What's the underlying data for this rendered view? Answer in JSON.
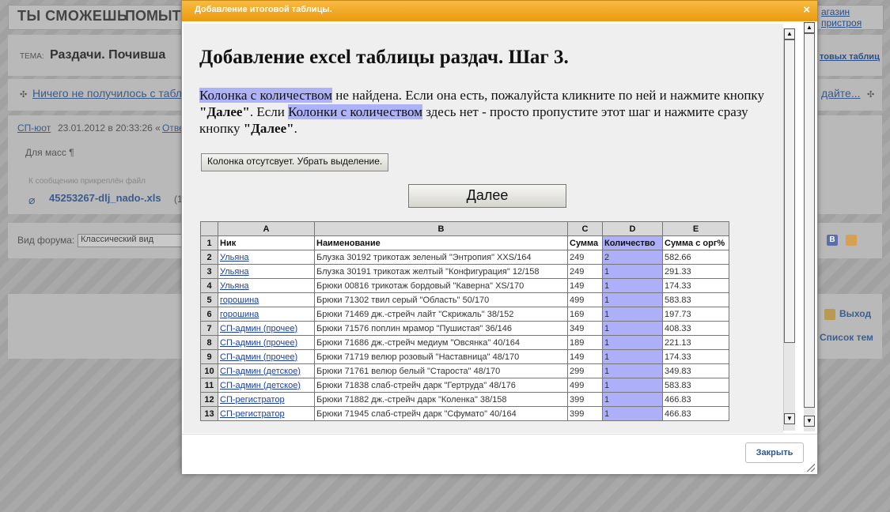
{
  "background": {
    "slogan_1": "ТЫ СМОЖЕШЬ",
    "slogan_2": "ПОМЫТЬ",
    "shop_link": "агазин пристроя",
    "topic_label": "ТЕМА:",
    "topic_title": "Раздачи. Почивша",
    "right_link": "товых таблиц",
    "nav_link_1": "Ничего не получилось с табл",
    "nav_link_2": "дайте...",
    "post_author": "СП-юот",
    "post_date": "23.01.2012 в 20:33:26 «",
    "post_reply": "Отве",
    "post_text": "Для масс ¶",
    "attach_label": "К сообщению прикреплён файл",
    "attach_file": "45253267-dlj_nado-.xls",
    "attach_extra": "(1",
    "forum_view_label": "Вид форума:",
    "forum_view_value": "Классический вид",
    "exit_link": "Выход",
    "topics_link": "Список тем"
  },
  "modal": {
    "title": "Добавление итоговой таблицы.",
    "close_glyph": "×",
    "heading": "Добавление excel таблицы раздач. Шаг 3.",
    "para_hl1": "Колонка с количеством",
    "para_t1": " не найдена. Если она есть, пожалуйста кликните по ней и нажмите кнопку ",
    "para_b1": "\"Далее\"",
    "para_t2": ". Если ",
    "para_hl2": "Колонки с количеством",
    "para_t3": " здесь нет - просто пропустите этот шаг и нажмите сразу кнопку ",
    "para_b2": "\"Далее\"",
    "para_t4": ".",
    "remove_button": "Колонка отсутсвует. Убрать выделение.",
    "next_button": "Далее",
    "close_button": "Закрыть"
  },
  "sheet": {
    "col_letters": [
      "A",
      "B",
      "C",
      "D",
      "E"
    ],
    "header_row": {
      "num": "1",
      "a": "Ник",
      "b": "Наименование",
      "c": "Сумма",
      "d": "Количество",
      "e": "Сумма с орг%"
    },
    "rows": [
      {
        "num": "2",
        "a": "Ульяна",
        "b": "Блузка 30192 трикотаж зеленый \"Энтропия\" XXS/164",
        "c": "249",
        "d": "2",
        "e": "582.66"
      },
      {
        "num": "3",
        "a": "Ульяна",
        "b": "Блузка 30191 трикотаж желтый \"Конфигурация\" 12/158",
        "c": "249",
        "d": "1",
        "e": "291.33"
      },
      {
        "num": "4",
        "a": "Ульяна",
        "b": "Брюки 00816 трикотаж бордовый \"Каверна\" XS/170",
        "c": "149",
        "d": "1",
        "e": "174.33"
      },
      {
        "num": "5",
        "a": "горошина",
        "b": "Брюки 71302 твил серый \"Область\" 50/170",
        "c": "499",
        "d": "1",
        "e": "583.83"
      },
      {
        "num": "6",
        "a": "горошина",
        "b": "Брюки 71469 дж.-стрейч лайт \"Скрижаль\" 38/152",
        "c": "169",
        "d": "1",
        "e": "197.73"
      },
      {
        "num": "7",
        "a": "СП-админ (прочее)",
        "b": "Брюки 71576 поплин мрамор \"Пушистая\" 36/146",
        "c": "349",
        "d": "1",
        "e": "408.33"
      },
      {
        "num": "8",
        "a": "СП-админ (прочее)",
        "b": "Брюки 71686 дж.-стрейч медиум \"Овсянка\" 40/164",
        "c": "189",
        "d": "1",
        "e": "221.13"
      },
      {
        "num": "9",
        "a": "СП-админ (прочее)",
        "b": "Брюки 71719 велюр розовый \"Наставница\" 48/170",
        "c": "149",
        "d": "1",
        "e": "174.33"
      },
      {
        "num": "10",
        "a": "СП-админ (детское)",
        "b": "Брюки 71761 велюр белый \"Староста\" 48/170",
        "c": "299",
        "d": "1",
        "e": "349.83"
      },
      {
        "num": "11",
        "a": "СП-админ (детское)",
        "b": "Брюки 71838 слаб-стрейч дарк \"Гертруда\" 48/176",
        "c": "499",
        "d": "1",
        "e": "583.83"
      },
      {
        "num": "12",
        "a": "СП-регистратор",
        "b": "Брюки 71882 дж.-стрейч дарк \"Коленка\" 38/158",
        "c": "399",
        "d": "1",
        "e": "466.83"
      },
      {
        "num": "13",
        "a": "СП-регистратор",
        "b": "Брюки 71945 слаб-стрейч дарк \"Сфумато\" 40/164",
        "c": "399",
        "d": "1",
        "e": "466.83"
      }
    ]
  },
  "colors": {
    "title_bar": "#f2a526",
    "highlight": "#aeb2f7",
    "link": "#1a3fa8"
  }
}
